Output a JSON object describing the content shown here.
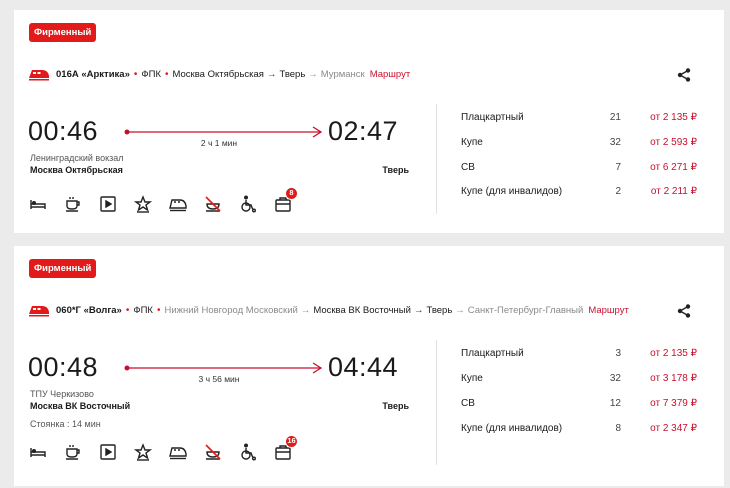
{
  "trains": [
    {
      "badge": "Фирменный",
      "number": "016А «Арктика»",
      "carrier": "ФПК",
      "route_stations": [
        {
          "name": "Москва Октябрьская",
          "muted": false
        },
        {
          "name": "Тверь",
          "muted": false
        },
        {
          "name": "Мурманск",
          "muted": true
        }
      ],
      "route_link": "Маршрут",
      "departure_time": "00:46",
      "arrival_time": "02:47",
      "duration": "2 ч 1 мин",
      "departure_station_sub": "Ленинградский вокзал",
      "departure_station": "Москва Октябрьская",
      "arrival_station": "Тверь",
      "stop_info": "",
      "services": [
        {
          "icon": "bed-icon"
        },
        {
          "icon": "coffee-icon"
        },
        {
          "icon": "video-icon"
        },
        {
          "icon": "star-icon"
        },
        {
          "icon": "train-icon"
        },
        {
          "icon": "no-food-icon"
        },
        {
          "icon": "wheelchair-icon"
        },
        {
          "icon": "medkit-icon",
          "badge": "8"
        }
      ],
      "classes": [
        {
          "name": "Плацкартный",
          "seats": "21",
          "price": "от 2 135 ₽"
        },
        {
          "name": "Купе",
          "seats": "32",
          "price": "от 2 593 ₽"
        },
        {
          "name": "СВ",
          "seats": "7",
          "price": "от 6 271 ₽"
        },
        {
          "name": "Купе (для инвалидов)",
          "seats": "2",
          "price": "от 2 211 ₽"
        }
      ]
    },
    {
      "badge": "Фирменный",
      "number": "060*Г «Волга»",
      "carrier": "ФПК",
      "route_stations": [
        {
          "name": "Нижний Новгород Московский",
          "muted": true
        },
        {
          "name": "Москва ВК Восточный",
          "muted": false
        },
        {
          "name": "Тверь",
          "muted": false
        },
        {
          "name": "Санкт-Петербург-Главный",
          "muted": true
        }
      ],
      "route_link": "Маршрут",
      "departure_time": "00:48",
      "arrival_time": "04:44",
      "duration": "3 ч 56 мин",
      "departure_station_sub": "ТПУ Черкизово",
      "departure_station": "Москва ВК Восточный",
      "arrival_station": "Тверь",
      "stop_info": "Стоянка : 14 мин",
      "services": [
        {
          "icon": "bed-icon"
        },
        {
          "icon": "coffee-icon"
        },
        {
          "icon": "video-icon"
        },
        {
          "icon": "star-icon"
        },
        {
          "icon": "train-icon"
        },
        {
          "icon": "no-food-icon"
        },
        {
          "icon": "wheelchair-icon"
        },
        {
          "icon": "medkit-icon",
          "badge": "16"
        }
      ],
      "classes": [
        {
          "name": "Плацкартный",
          "seats": "3",
          "price": "от 2 135 ₽"
        },
        {
          "name": "Купе",
          "seats": "32",
          "price": "от 3 178 ₽"
        },
        {
          "name": "СВ",
          "seats": "12",
          "price": "от 7 379 ₽"
        },
        {
          "name": "Купе (для инвалидов)",
          "seats": "8",
          "price": "от 2 347 ₽"
        }
      ]
    }
  ],
  "colors": {
    "accent": "#e21a1a",
    "price": "#c8102e",
    "muted": "#8a8a8a"
  }
}
